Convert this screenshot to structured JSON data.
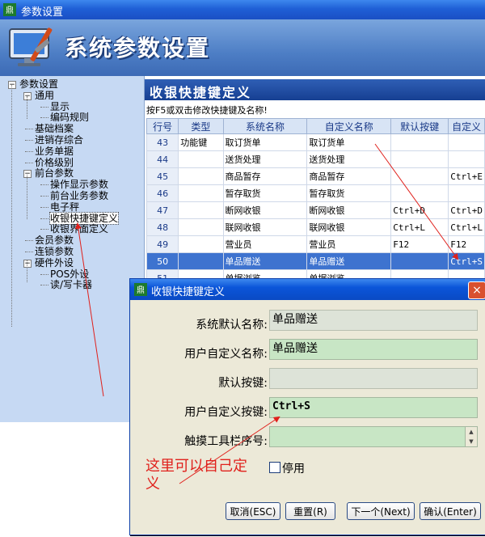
{
  "window": {
    "title": "参数设置",
    "banner_title": "系统参数设置"
  },
  "tree": {
    "items": [
      {
        "label": "参数设置",
        "level": 0,
        "expander": "−"
      },
      {
        "label": "通用",
        "level": 1,
        "expander": "−"
      },
      {
        "label": "显示",
        "level": 2
      },
      {
        "label": "编码规则",
        "level": 2
      },
      {
        "label": "基础档案",
        "level": 1
      },
      {
        "label": "进销存综合",
        "level": 1
      },
      {
        "label": "业务单据",
        "level": 1
      },
      {
        "label": "价格级别",
        "level": 1
      },
      {
        "label": "前台参数",
        "level": 1,
        "expander": "−"
      },
      {
        "label": "操作显示参数",
        "level": 2
      },
      {
        "label": "前台业务参数",
        "level": 2
      },
      {
        "label": "电子秤",
        "level": 2
      },
      {
        "label": "收银快捷键定义",
        "level": 2,
        "selected": true
      },
      {
        "label": "收银界面定义",
        "level": 2
      },
      {
        "label": "会员参数",
        "level": 1
      },
      {
        "label": "连锁参数",
        "level": 1
      },
      {
        "label": "硬件外设",
        "level": 1,
        "expander": "−"
      },
      {
        "label": "POS外设",
        "level": 2
      },
      {
        "label": "读/写卡器",
        "level": 2
      }
    ]
  },
  "grid": {
    "title": "收银快捷键定义",
    "hint": "按F5或双击修改快捷键及名称!",
    "columns": [
      "行号",
      "类型",
      "系统名称",
      "自定义名称",
      "默认按键",
      "自定义"
    ],
    "rows": [
      {
        "no": "43",
        "type": "功能键",
        "sys": "取订货单",
        "custom": "取订货单",
        "default_key": "",
        "custom_key": ""
      },
      {
        "no": "44",
        "type": "",
        "sys": "送货处理",
        "custom": "送货处理",
        "default_key": "",
        "custom_key": ""
      },
      {
        "no": "45",
        "type": "",
        "sys": "商品暂存",
        "custom": "商品暂存",
        "default_key": "",
        "custom_key": "Ctrl+E"
      },
      {
        "no": "46",
        "type": "",
        "sys": "暂存取货",
        "custom": "暂存取货",
        "default_key": "",
        "custom_key": ""
      },
      {
        "no": "47",
        "type": "",
        "sys": "断网收银",
        "custom": "断网收银",
        "default_key": "Ctrl+D",
        "custom_key": "Ctrl+D"
      },
      {
        "no": "48",
        "type": "",
        "sys": "联网收银",
        "custom": "联网收银",
        "default_key": "Ctrl+L",
        "custom_key": "Ctrl+L"
      },
      {
        "no": "49",
        "type": "",
        "sys": "营业员",
        "custom": "营业员",
        "default_key": "F12",
        "custom_key": "F12"
      },
      {
        "no": "50",
        "type": "",
        "sys": "单品赠送",
        "custom": "单品赠送",
        "default_key": "",
        "custom_key": "Ctrl+S",
        "selected": true
      },
      {
        "no": "51",
        "type": "",
        "sys": "单据浏览",
        "custom": "单据浏览",
        "default_key": "",
        "custom_key": ""
      }
    ]
  },
  "dialog": {
    "title": "收银快捷键定义",
    "close": "×",
    "fields": {
      "sys_name_label": "系统默认名称:",
      "sys_name_value": "单品赠送",
      "user_name_label": "用户自定义名称:",
      "user_name_value": "单品赠送",
      "default_key_label": "默认按键:",
      "default_key_value": "",
      "user_key_label": "用户自定义按键:",
      "user_key_value": "Ctrl+S",
      "touch_label": "触摸工具栏序号:",
      "touch_value": ""
    },
    "disable_label": "停用",
    "buttons": {
      "cancel": "取消(ESC)",
      "reset": "重置(R)",
      "next": "下一个(Next)",
      "confirm": "确认(Enter)"
    }
  },
  "annotation": {
    "text": "这里可以自己定义",
    "color": "#e0211c"
  }
}
